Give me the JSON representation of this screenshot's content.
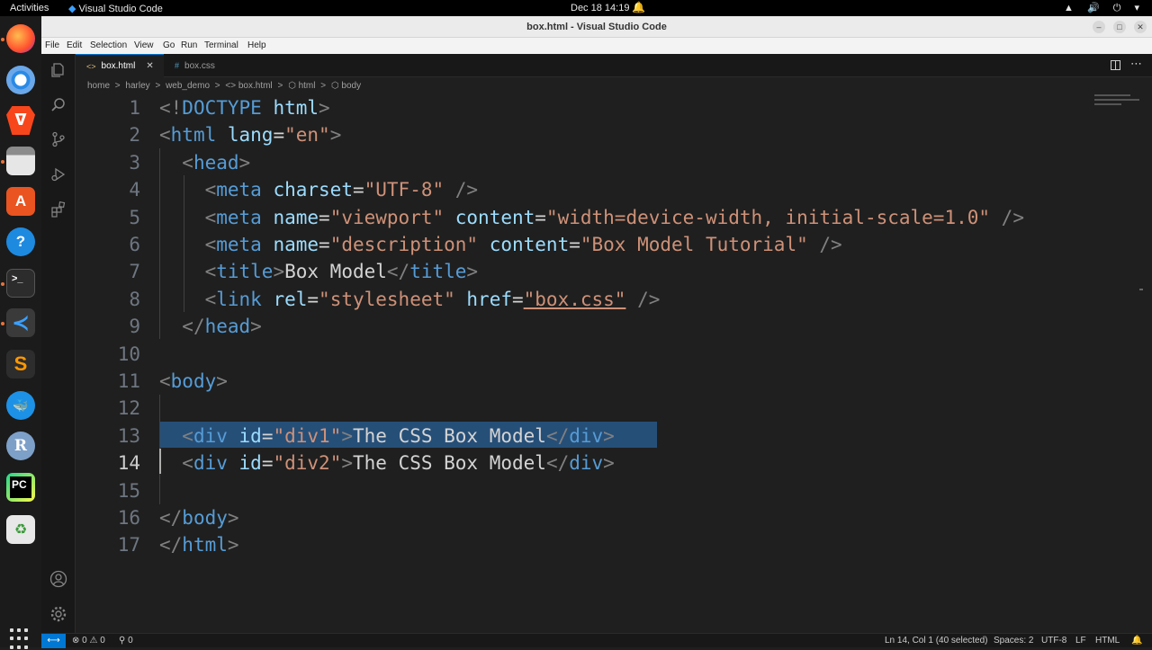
{
  "topbar": {
    "activities": "Activities",
    "app_name": "Visual Studio Code",
    "clock": "Dec 18  14:19",
    "bell": "🔔",
    "tray": "▲ 🔊 ⏻ ▾"
  },
  "window": {
    "title": "box.html - Visual Studio Code",
    "min": "–",
    "max": "□",
    "close": "✕"
  },
  "menu": [
    "File",
    "Edit",
    "Selection",
    "View",
    "Go",
    "Run",
    "Terminal",
    "Help"
  ],
  "tabs": [
    {
      "label": "box.html",
      "icon": "<>",
      "close": "✕"
    },
    {
      "label": "box.css",
      "icon": "#"
    }
  ],
  "breadcrumb": [
    "home",
    ">",
    "harley",
    ">",
    "web_demo",
    ">",
    "<> box.html",
    ">",
    "⬡ html",
    ">",
    "⬡ body"
  ],
  "editor": {
    "line_numbers": [
      "1",
      "2",
      "3",
      "4",
      "5",
      "6",
      "7",
      "8",
      "9",
      "10",
      "11",
      "12",
      "13",
      "14",
      "15",
      "16",
      "17"
    ],
    "current_line": 14,
    "selected_line": 13,
    "lines": [
      [
        {
          "t": "<!",
          "c": "pt"
        },
        {
          "t": "DOCTYPE",
          "c": "tg"
        },
        {
          "t": " html",
          "c": "at"
        },
        {
          "t": ">",
          "c": "pt"
        }
      ],
      [
        {
          "t": "<",
          "c": "pt"
        },
        {
          "t": "html",
          "c": "tg"
        },
        {
          "t": " lang",
          "c": "at"
        },
        {
          "t": "=",
          "c": "tx"
        },
        {
          "t": "\"en\"",
          "c": "sv"
        },
        {
          "t": ">",
          "c": "pt"
        }
      ],
      [
        {
          "t": "  "
        },
        {
          "t": "<",
          "c": "pt"
        },
        {
          "t": "head",
          "c": "tg"
        },
        {
          "t": ">",
          "c": "pt"
        }
      ],
      [
        {
          "t": "    "
        },
        {
          "t": "<",
          "c": "pt"
        },
        {
          "t": "meta",
          "c": "tg"
        },
        {
          "t": " charset",
          "c": "at"
        },
        {
          "t": "=",
          "c": "tx"
        },
        {
          "t": "\"UTF-8\"",
          "c": "sv"
        },
        {
          "t": " />",
          "c": "pt"
        }
      ],
      [
        {
          "t": "    "
        },
        {
          "t": "<",
          "c": "pt"
        },
        {
          "t": "meta",
          "c": "tg"
        },
        {
          "t": " name",
          "c": "at"
        },
        {
          "t": "=",
          "c": "tx"
        },
        {
          "t": "\"viewport\"",
          "c": "sv"
        },
        {
          "t": " content",
          "c": "at"
        },
        {
          "t": "=",
          "c": "tx"
        },
        {
          "t": "\"width=device-width, initial-scale=1.0\"",
          "c": "sv"
        },
        {
          "t": " />",
          "c": "pt"
        }
      ],
      [
        {
          "t": "    "
        },
        {
          "t": "<",
          "c": "pt"
        },
        {
          "t": "meta",
          "c": "tg"
        },
        {
          "t": " name",
          "c": "at"
        },
        {
          "t": "=",
          "c": "tx"
        },
        {
          "t": "\"description\"",
          "c": "sv"
        },
        {
          "t": " content",
          "c": "at"
        },
        {
          "t": "=",
          "c": "tx"
        },
        {
          "t": "\"Box Model Tutorial\"",
          "c": "sv"
        },
        {
          "t": " />",
          "c": "pt"
        }
      ],
      [
        {
          "t": "    "
        },
        {
          "t": "<",
          "c": "pt"
        },
        {
          "t": "title",
          "c": "tg"
        },
        {
          "t": ">",
          "c": "pt"
        },
        {
          "t": "Box Model",
          "c": "tx"
        },
        {
          "t": "</",
          "c": "pt"
        },
        {
          "t": "title",
          "c": "tg"
        },
        {
          "t": ">",
          "c": "pt"
        }
      ],
      [
        {
          "t": "    "
        },
        {
          "t": "<",
          "c": "pt"
        },
        {
          "t": "link",
          "c": "tg"
        },
        {
          "t": " rel",
          "c": "at"
        },
        {
          "t": "=",
          "c": "tx"
        },
        {
          "t": "\"stylesheet\"",
          "c": "sv"
        },
        {
          "t": " href",
          "c": "at"
        },
        {
          "t": "=",
          "c": "tx"
        },
        {
          "t": "\"box.css\"",
          "c": "sv",
          "u": true
        },
        {
          "t": " />",
          "c": "pt"
        }
      ],
      [
        {
          "t": "  "
        },
        {
          "t": "</",
          "c": "pt"
        },
        {
          "t": "head",
          "c": "tg"
        },
        {
          "t": ">",
          "c": "pt"
        }
      ],
      [],
      [
        {
          "t": "<",
          "c": "pt"
        },
        {
          "t": "body",
          "c": "tg"
        },
        {
          "t": ">",
          "c": "pt"
        }
      ],
      [],
      [
        {
          "t": "  "
        },
        {
          "t": "<",
          "c": "pt"
        },
        {
          "t": "div",
          "c": "tg"
        },
        {
          "t": " id",
          "c": "at"
        },
        {
          "t": "=",
          "c": "tx"
        },
        {
          "t": "\"div1\"",
          "c": "sv"
        },
        {
          "t": ">",
          "c": "pt"
        },
        {
          "t": "The CSS Box Model",
          "c": "tx"
        },
        {
          "t": "</",
          "c": "pt"
        },
        {
          "t": "div",
          "c": "tg"
        },
        {
          "t": ">",
          "c": "pt"
        }
      ],
      [
        {
          "t": "  "
        },
        {
          "t": "<",
          "c": "pt"
        },
        {
          "t": "div",
          "c": "tg"
        },
        {
          "t": " id",
          "c": "at"
        },
        {
          "t": "=",
          "c": "tx"
        },
        {
          "t": "\"div2\"",
          "c": "sv"
        },
        {
          "t": ">",
          "c": "pt"
        },
        {
          "t": "The CSS Box Model",
          "c": "tx"
        },
        {
          "t": "</",
          "c": "pt"
        },
        {
          "t": "div",
          "c": "tg"
        },
        {
          "t": ">",
          "c": "pt"
        }
      ],
      [],
      [
        {
          "t": "</",
          "c": "pt"
        },
        {
          "t": "body",
          "c": "tg"
        },
        {
          "t": ">",
          "c": "pt"
        }
      ],
      [
        {
          "t": "</",
          "c": "pt"
        },
        {
          "t": "html",
          "c": "tg"
        },
        {
          "t": ">",
          "c": "pt"
        }
      ]
    ]
  },
  "status": {
    "remote": "⟷",
    "problems": "⊗ 0 ⚠ 0",
    "ports": "⚲ 0",
    "position": "Ln 14, Col 1 (40 selected)",
    "spaces": "Spaces: 2",
    "encoding": "UTF-8",
    "eol": "LF",
    "language": "HTML",
    "notifications": "🔔"
  },
  "colors": {
    "accent": "#0078d4",
    "selection": "#264f78",
    "tag": "#569cd6",
    "attr": "#9cdcfe",
    "string": "#ce9178"
  },
  "dock_icons": [
    "firefox-icon",
    "chromium-icon",
    "brave-icon",
    "files-icon",
    "app-center-icon",
    "help-icon",
    "terminal-icon",
    "vscode-icon",
    "sublime-icon",
    "docker-icon",
    "r-icon",
    "pycharm-icon",
    "trash-icon",
    "apps-grid-icon"
  ]
}
